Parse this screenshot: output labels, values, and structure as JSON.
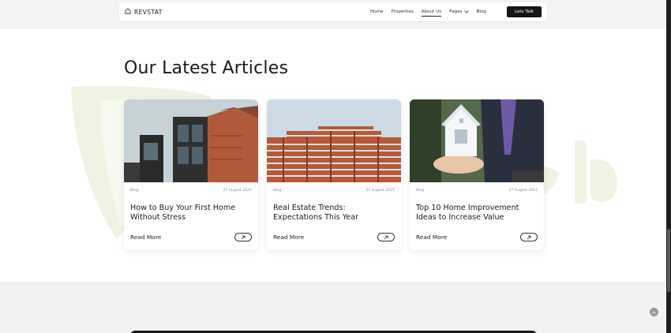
{
  "brand": {
    "name": "REVSTAT",
    "icon": "home-outline-icon"
  },
  "nav": {
    "items": [
      {
        "label": "Home",
        "active": false
      },
      {
        "label": "Properties",
        "active": false
      },
      {
        "label": "About Us",
        "active": true
      },
      {
        "label": "Pages",
        "active": false,
        "dropdown": true
      },
      {
        "label": "Blog",
        "active": false
      }
    ],
    "cta": "Lets Talk"
  },
  "section": {
    "title": "Our Latest Articles"
  },
  "articles": [
    {
      "category": "Blog",
      "date": "27 August 2021",
      "title": "How to Buy Your First Home Without Stress",
      "read_more": "Read More",
      "image": "modern-brick-house"
    },
    {
      "category": "Blog",
      "date": "27 August 2021",
      "title": "Real Estate Trends: Expectations This Year",
      "read_more": "Read More",
      "image": "apartment-block"
    },
    {
      "category": "Blog",
      "date": "27 August 2021",
      "title": "Top 10 Home Improvement Ideas to Increase Value",
      "read_more": "Read More",
      "image": "hand-holding-house-model"
    }
  ],
  "colors": {
    "accent": "#151515",
    "watermark": "#eef3e3"
  }
}
